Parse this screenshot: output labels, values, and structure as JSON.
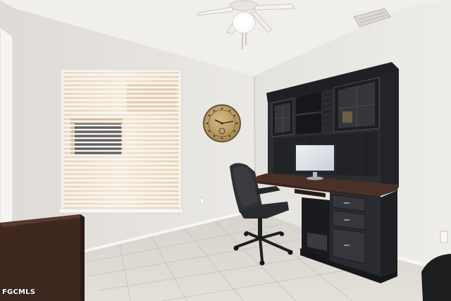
{
  "photo": {
    "watermark": "FGCMLS",
    "subject": [
      "ceiling-fan-icon",
      "window-blinds",
      "wall-clock-icon",
      "computer-hutch-desk",
      "computer-monitor-icon",
      "office-chair-icon",
      "tile-floor"
    ],
    "colors": {
      "wall": "#e9e7e4",
      "ceiling": "#f0eeeb",
      "floor": "#d9d6d0",
      "hutch": "#2b2c2f",
      "desktop_wood": "#4a3026",
      "clock_face": "#c4a56a",
      "window_glow": "#f1e4d2"
    }
  }
}
